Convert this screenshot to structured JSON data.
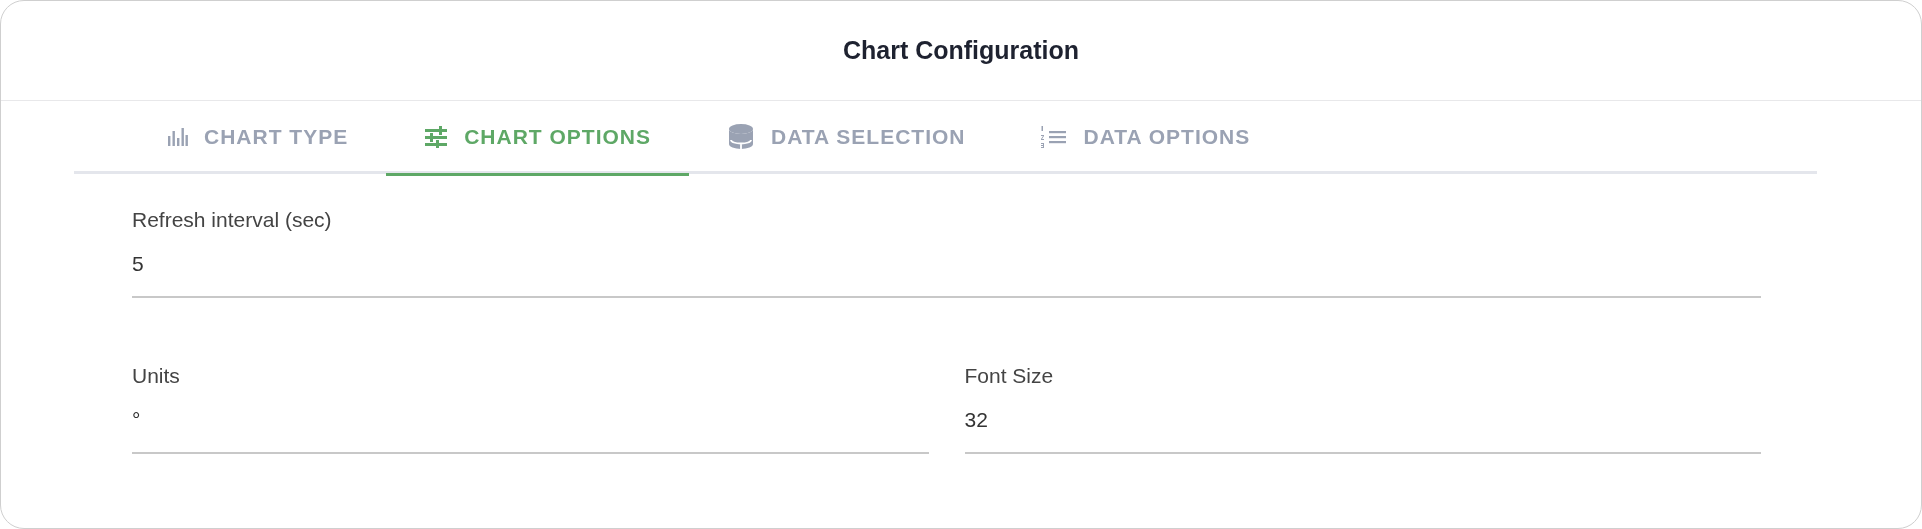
{
  "title": "Chart Configuration",
  "tabs": [
    {
      "label": "CHART TYPE",
      "selected": false
    },
    {
      "label": "CHART OPTIONS",
      "selected": true
    },
    {
      "label": "DATA SELECTION",
      "selected": false
    },
    {
      "label": "DATA OPTIONS",
      "selected": false
    }
  ],
  "rows": [
    [
      {
        "label": "Refresh interval (sec)",
        "value": "5"
      }
    ],
    [
      {
        "label": "Units",
        "value": "°"
      },
      {
        "label": "Font Size",
        "value": "32"
      }
    ]
  ]
}
